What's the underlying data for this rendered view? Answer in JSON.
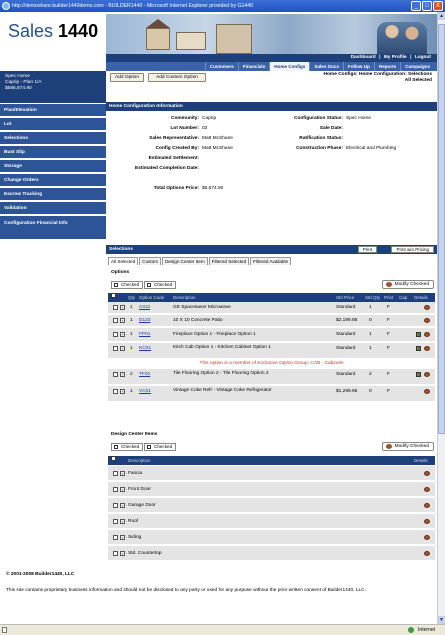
{
  "window": {
    "title": "http://demoshare.builder1440demo.com - BUILDER1440 - Microsoft Internet Explorer provided by G1440",
    "minimize": "_",
    "maximize": "□",
    "close": "X"
  },
  "statusbar": {
    "zone": "Internet"
  },
  "header": {
    "logo_primary": "Sales ",
    "logo_secondary": "1440",
    "top_links": [
      "Dashboard",
      "|",
      "My Profile",
      "|",
      "Logout"
    ]
  },
  "nav_tabs": [
    {
      "label": "Customers",
      "active": false
    },
    {
      "label": "Financials",
      "active": false
    },
    {
      "label": "Home Configs",
      "active": true
    },
    {
      "label": "Sales Docs",
      "active": false
    },
    {
      "label": "Follow Up",
      "active": false
    },
    {
      "label": "Reports",
      "active": false
    },
    {
      "label": "Campaigns",
      "active": false
    }
  ],
  "sidebar": {
    "project_lines": [
      "Spec Home",
      "Caprip - Plan 1/A",
      "$686,874.90"
    ],
    "items": [
      "Plan/Elevation",
      "Lot",
      "Selections",
      "Bust Slip",
      "Storage",
      "Change Orders",
      "Escrow Tracking",
      "Validation",
      "Configuration Financial Info"
    ]
  },
  "actions": {
    "add_option": "Add Option",
    "add_custom_option": "Add Custom Option"
  },
  "page_title_lines": [
    "Home Configs: Home Configuration: Selections",
    "All Selected"
  ],
  "info": {
    "section_title": "Home Configuration Information",
    "left": [
      {
        "label": "Community:",
        "value": "Caprip"
      },
      {
        "label": "Lot Number:",
        "value": "02"
      },
      {
        "label": "Sales Representative:",
        "value": "Matt McShane"
      },
      {
        "label": "Config Created By:",
        "value": "Matt McShane"
      },
      {
        "label": "Estimated Settlement:",
        "value": ""
      },
      {
        "label": "Estimated Completion Date:",
        "value": ""
      },
      {
        "label": "Total Options Price:",
        "value": "$6,674.90"
      }
    ],
    "right": [
      {
        "label": "Configuration Status:",
        "value": "Spec Home"
      },
      {
        "label": "Sale Date:",
        "value": ""
      },
      {
        "label": "Ratification Status:",
        "value": ""
      },
      {
        "label": "Construction Phase:",
        "value": "Electrical and Plumbing"
      }
    ]
  },
  "selections": {
    "section_title": "Selections",
    "print_label": "Print",
    "print_pricing_label": "Print w/o Pricing",
    "subtabs": [
      {
        "label": "All Selected",
        "active": true
      },
      {
        "label": "Custom",
        "active": false
      },
      {
        "label": "Design Center Item",
        "active": false
      },
      {
        "label": "Filtered Selected",
        "active": false
      },
      {
        "label": "Filtered Available",
        "active": false
      }
    ]
  },
  "options": {
    "title": "Options",
    "checked_label": "Checked",
    "checked_label_2": "Checked",
    "modify_label": "Modify Checked",
    "columns": [
      "Qty",
      "Option Code",
      "Description",
      "Std Price",
      "Std Qty",
      "Print",
      "Cap",
      "Details"
    ],
    "rows": [
      {
        "qty": "1",
        "code": "A312",
        "desc": "GE Spacesaver Microwave",
        "price": "Standard",
        "std_qty": "1",
        "print": "F",
        "has_note": false
      },
      {
        "qty": "1",
        "code": "D123",
        "desc": "10 X 10 Concrete Patio",
        "price": "$2,199.95",
        "std_qty": "0",
        "print": "F",
        "has_note": false
      },
      {
        "qty": "1",
        "code": "FP01",
        "desc": "Fireplace Option 1 - Fireplace Option 1",
        "price": "Standard",
        "std_qty": "1",
        "print": "F",
        "has_note": true
      },
      {
        "qty": "1",
        "code": "KC01",
        "desc": "Kitch Cab Option 1 - Kitchen Cabinet Option 1",
        "price": "Standard",
        "std_qty": "1",
        "print": "F",
        "has_note": true
      },
      {
        "qty": "2",
        "code": "TF02",
        "desc": "Tile Flooring Option 2 - Tile Flooring Option 2",
        "price": "Standard",
        "std_qty": "2",
        "print": "F",
        "has_note": true
      },
      {
        "qty": "1",
        "code": "VC01",
        "desc": "Vintage Coke Refr - Vintage Coke Refrigerator",
        "price": "$1,299.95",
        "std_qty": "0",
        "print": "F",
        "has_note": false
      }
    ],
    "warning": "This option is a member of Exclusive Option Group: CAB - Cabinets"
  },
  "design_center": {
    "title": "Design Center Items",
    "checked_label": "Checked",
    "checked_label_2": "Checked",
    "modify_label": "Modify Checked",
    "columns": [
      "Description",
      "Details"
    ],
    "rows": [
      "Fascia",
      "Front Door",
      "Garage Door",
      "Roof",
      "Siding",
      "Std. Countertop"
    ]
  },
  "footer": {
    "copyright": "© 2001-2008 Builder1440, LLC",
    "notice": "This site contains proprietary business information and should not be disclosed to any party or used for any purpose without the prior written consent of Builder1440, LLC."
  },
  "colors": {
    "nav_dark": "#1d3f7a",
    "nav_mid": "#2c5496",
    "warning": "#c0392b",
    "row_bg": "#e4e4e4"
  }
}
